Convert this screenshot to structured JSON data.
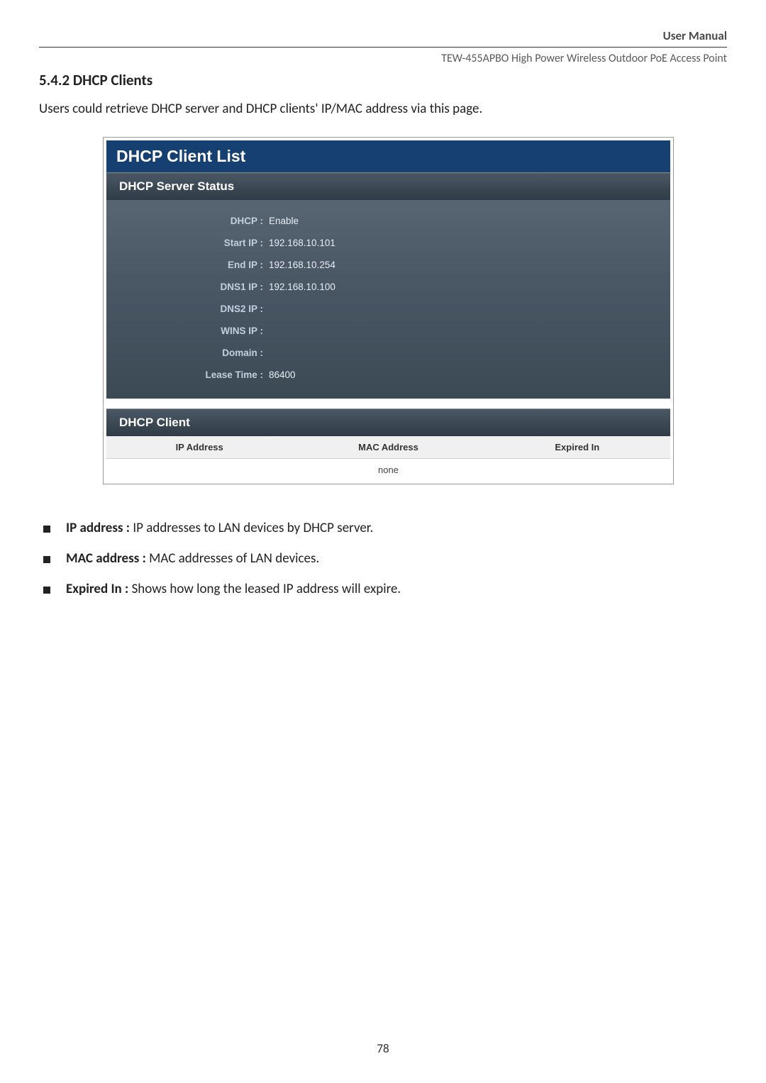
{
  "header": {
    "manual_label": "User Manual",
    "device_line": "TEW-455APBO High Power Wireless Outdoor PoE Access Point"
  },
  "section": {
    "number_title": "5.4.2 DHCP Clients",
    "intro": "Users could retrieve DHCP server and DHCP clients' IP/MAC address via this page."
  },
  "panel": {
    "title": "DHCP Client List",
    "server_status_heading": "DHCP Server Status",
    "client_heading": "DHCP Client",
    "rows": [
      {
        "label": "DHCP :",
        "value": "Enable"
      },
      {
        "label": "Start IP :",
        "value": "192.168.10.101"
      },
      {
        "label": "End IP :",
        "value": "192.168.10.254"
      },
      {
        "label": "DNS1 IP :",
        "value": "192.168.10.100"
      },
      {
        "label": "DNS2 IP :",
        "value": ""
      },
      {
        "label": "WINS IP :",
        "value": ""
      },
      {
        "label": "Domain :",
        "value": ""
      },
      {
        "label": "Lease Time :",
        "value": "86400"
      }
    ],
    "client_table": {
      "headers": [
        "IP Address",
        "MAC Address",
        "Expired In"
      ],
      "empty_text": "none"
    }
  },
  "bullets": [
    {
      "bold": "IP address : ",
      "text": "IP addresses to LAN devices by DHCP server."
    },
    {
      "bold": "MAC address : ",
      "text": "MAC addresses of LAN devices."
    },
    {
      "bold": "Expired In : ",
      "text": "Shows how long the leased IP address will expire."
    }
  ],
  "page_number": "78"
}
